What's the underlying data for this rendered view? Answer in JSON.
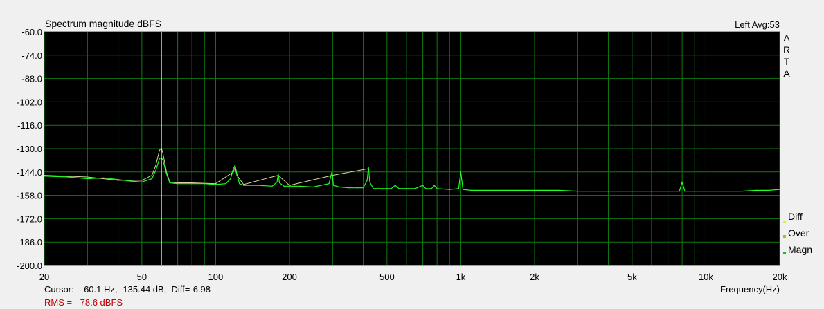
{
  "window": {
    "title": "Spectrum magnitude dBFS",
    "channel_info": "Left  Avg:53",
    "brand_letters": [
      "A",
      "R",
      "T",
      "A"
    ]
  },
  "status": {
    "cursor_text": "Cursor:    60.1 Hz, -135.44 dB,  Diff=-6.98",
    "rms_text": "RMS =  -78.6 dBFS"
  },
  "legend": [
    {
      "label": "Diff",
      "color": "#f0f000"
    },
    {
      "label": "Over",
      "color": "#c8b400"
    },
    {
      "label": "Magn",
      "color": "#00d000"
    }
  ],
  "colors": {
    "plot_background": "#000000",
    "grid": "#0f7a0f",
    "trace": "#22ff22",
    "trace_over": "#d8d8a0",
    "cursor": "#fff8c0",
    "rms_text": "#c00000"
  },
  "chart_data": {
    "type": "line",
    "title": "Spectrum magnitude dBFS",
    "xlabel": "Frequency(Hz)",
    "ylabel": "",
    "x_scale": "log",
    "xlim": [
      20,
      20000
    ],
    "ylim": [
      -200,
      -60
    ],
    "grid": true,
    "x_ticks": [
      20,
      50,
      100,
      200,
      500,
      1000,
      2000,
      5000,
      10000,
      20000
    ],
    "x_tick_labels": [
      "20",
      "50",
      "100",
      "200",
      "500",
      "1k",
      "2k",
      "5k",
      "10k",
      "20k"
    ],
    "y_ticks": [
      -60,
      -74,
      -88,
      -102,
      -116,
      -130,
      -144,
      -158,
      -172,
      -186,
      -200
    ],
    "y_tick_labels": [
      "-60.0",
      "-74.0",
      "-88.0",
      "-102.0",
      "-116.0",
      "-130.0",
      "-144.0",
      "-158.0",
      "-172.0",
      "-186.0",
      "-200.0"
    ],
    "cursor": {
      "x": 60.1,
      "y": -135.44
    },
    "series": [
      {
        "name": "Magn",
        "x": [
          20,
          25,
          30,
          35,
          40,
          45,
          50,
          55,
          57,
          59,
          60,
          61,
          63,
          65,
          70,
          80,
          90,
          100,
          110,
          115,
          118,
          120,
          122,
          125,
          130,
          150,
          170,
          178,
          180,
          182,
          190,
          220,
          250,
          290,
          298,
          300,
          302,
          320,
          350,
          380,
          400,
          415,
          420,
          425,
          440,
          480,
          520,
          540,
          560,
          580,
          650,
          700,
          720,
          760,
          780,
          800,
          900,
          980,
          1000,
          1020,
          1100,
          1500,
          2000,
          2500,
          3000,
          3500,
          4000,
          4500,
          5000,
          6000,
          7000,
          7800,
          8000,
          8200,
          9000,
          10000,
          12000,
          14000,
          16000,
          18000,
          20000
        ],
        "y": [
          -146.5,
          -147,
          -148,
          -147.5,
          -148.5,
          -149.5,
          -150,
          -148,
          -143,
          -136,
          -135.4,
          -137,
          -145,
          -150.5,
          -151,
          -151,
          -151,
          -151.5,
          -151,
          -148,
          -142,
          -140,
          -145,
          -151,
          -152,
          -152,
          -152.5,
          -150,
          -145,
          -150.5,
          -152.5,
          -152.5,
          -153,
          -151,
          -144,
          -147,
          -152,
          -153,
          -153.5,
          -153.5,
          -153.5,
          -149,
          -141,
          -150,
          -154,
          -154,
          -154,
          -152,
          -154,
          -154,
          -154,
          -152,
          -154,
          -154,
          -152,
          -154,
          -154.5,
          -154,
          -144,
          -154.5,
          -155,
          -155,
          -155,
          -155,
          -155.5,
          -155.5,
          -155.5,
          -155.5,
          -155.5,
          -155.5,
          -155.5,
          -155.5,
          -150,
          -155.5,
          -155.5,
          -155.5,
          -155.5,
          -155.5,
          -155,
          -155,
          -154.5
        ]
      },
      {
        "name": "Over",
        "x": [
          20,
          30,
          40,
          50,
          55,
          57,
          59,
          60,
          61,
          63,
          65,
          70,
          80,
          100,
          118,
          120,
          122,
          130,
          180,
          200,
          300,
          420
        ],
        "y": [
          -146,
          -147,
          -149,
          -149,
          -146,
          -140,
          -131,
          -129.5,
          -133,
          -144,
          -150,
          -150.5,
          -150.5,
          -151,
          -144,
          -141,
          -146,
          -151.5,
          -146,
          -152,
          -146,
          -142
        ]
      }
    ]
  }
}
